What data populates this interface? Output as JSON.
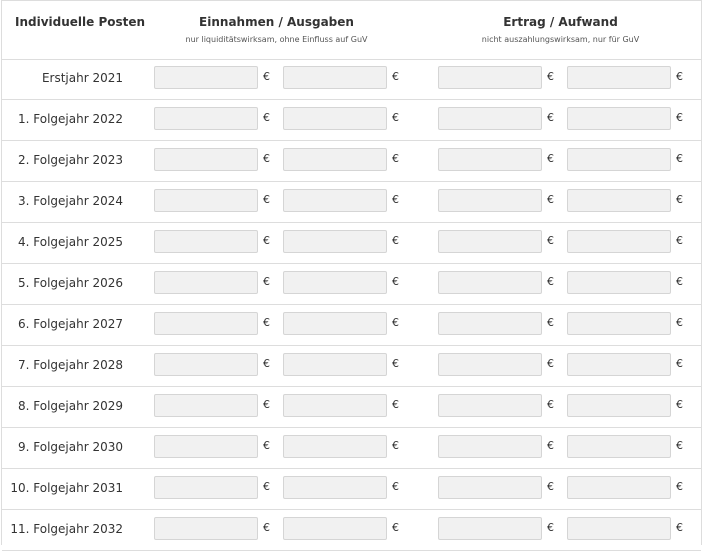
{
  "header": {
    "label": "Individuelle Posten",
    "col1_title": "Einnahmen / Ausgaben",
    "col1_sub": "nur liquiditätswirksam, ohne Einfluss auf GuV",
    "col2_title": "Ertrag / Aufwand",
    "col2_sub": "nicht auszahlungswirksam, nur für GuV"
  },
  "currency": "€",
  "rows": [
    {
      "label": "Erstjahr 2021",
      "values": [
        "",
        "",
        "",
        ""
      ]
    },
    {
      "label": "1. Folgejahr 2022",
      "values": [
        "",
        "",
        "",
        ""
      ]
    },
    {
      "label": "2. Folgejahr 2023",
      "values": [
        "",
        "",
        "",
        ""
      ]
    },
    {
      "label": "3. Folgejahr 2024",
      "values": [
        "",
        "",
        "",
        ""
      ]
    },
    {
      "label": "4. Folgejahr 2025",
      "values": [
        "",
        "",
        "",
        ""
      ]
    },
    {
      "label": "5. Folgejahr 2026",
      "values": [
        "",
        "",
        "",
        ""
      ]
    },
    {
      "label": "6. Folgejahr 2027",
      "values": [
        "",
        "",
        "",
        ""
      ]
    },
    {
      "label": "7. Folgejahr 2028",
      "values": [
        "",
        "",
        "",
        ""
      ]
    },
    {
      "label": "8. Folgejahr 2029",
      "values": [
        "",
        "",
        "",
        ""
      ]
    },
    {
      "label": "9. Folgejahr 2030",
      "values": [
        "",
        "",
        "",
        ""
      ]
    },
    {
      "label": "10. Folgejahr 2031",
      "values": [
        "",
        "",
        "",
        ""
      ]
    },
    {
      "label": "11. Folgejahr 2032",
      "values": [
        "",
        "",
        "",
        ""
      ]
    }
  ]
}
